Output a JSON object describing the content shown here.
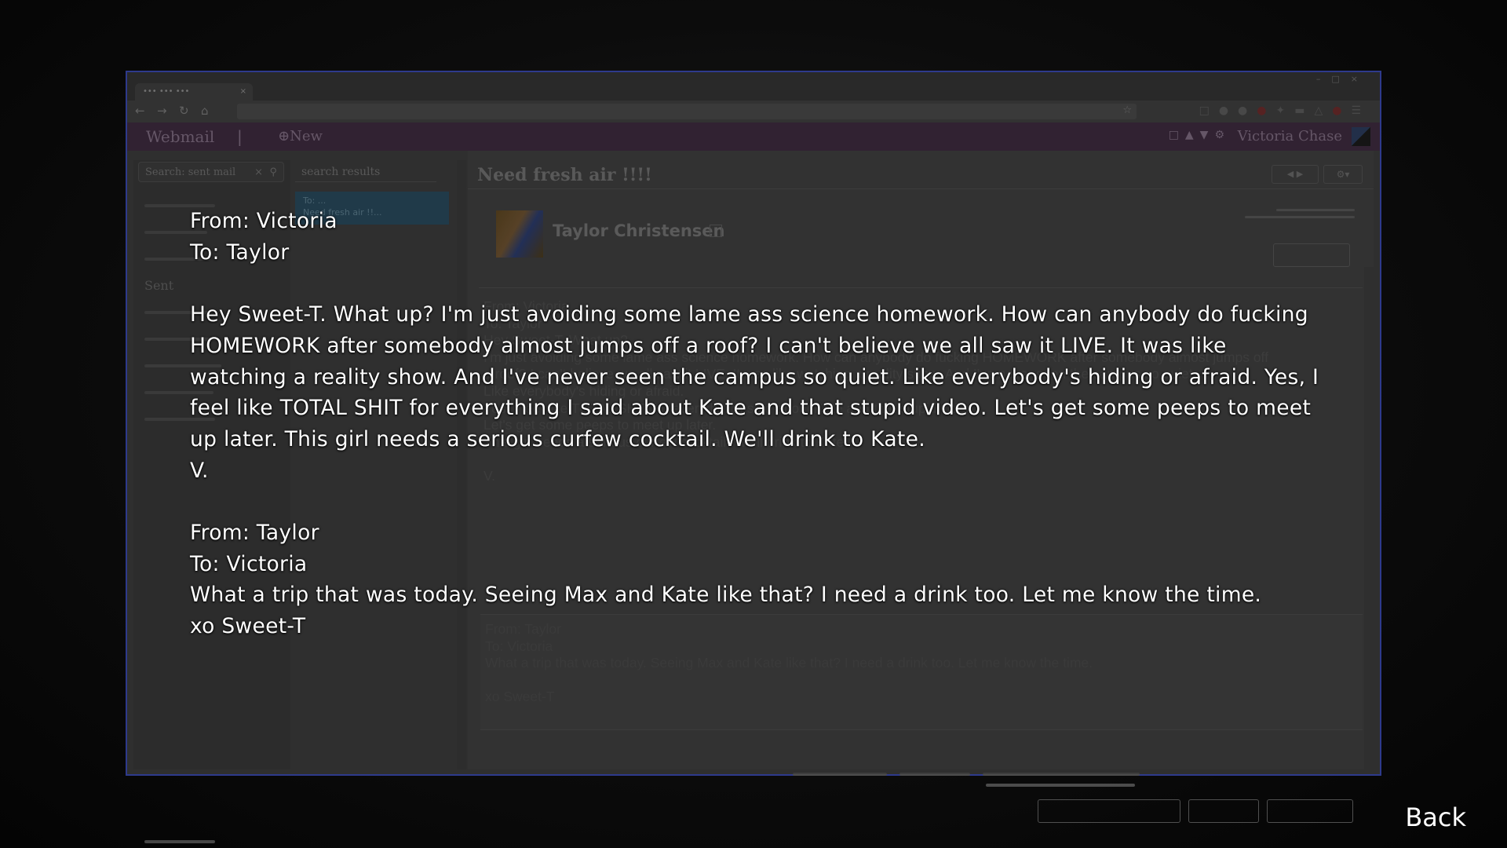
{
  "browser": {
    "tab_title": "••• ••• •••",
    "tab_close": "×"
  },
  "webmail": {
    "brand": "Webmail",
    "new_label": "⊕New",
    "user": "Victoria Chase",
    "search_sent_placeholder": "Search: sent mail",
    "sidebar_sent_label": "Sent",
    "search_results_label": "search results",
    "result_item_from": "To: ...",
    "result_item_subject": "Need fresh air !!...",
    "subject": "Need fresh air !!!!",
    "sender": "Taylor Christensen",
    "body_lines": [
      "From: Victoria",
      "To: Taylor",
      "Hey Sweet-T. What up?",
      "I'm just avoiding some lame ass science homework. How can anybody do fucking HOMEWORK after somebody almost jumps off",
      "a roof? I can't believe we all saw it LIVE. It was like watching a reality show. And I've never seen the campus so quiet.",
      "Like everybody's hiding or afraid.",
      "Yes, I feel like TOTAL SHIT for everything I said about Kate and that stupid video.",
      "Let's get some peeps to meet up later.",
      "This girl needs a serious curfew cocktail. We'll drink to Kate.",
      "",
      "V."
    ],
    "quoted_lines": [
      "From: Taylor",
      "To: Victoria",
      "What a trip that was today. Seeing Max and Kate like that? I need a drink too. Let me know the time.",
      "",
      "xo Sweet-T"
    ]
  },
  "journal": {
    "message1": {
      "from": "From: Victoria",
      "to": "To: Taylor",
      "body": "Hey Sweet-T. What up? I'm just avoiding some lame ass science homework. How can anybody do fucking HOMEWORK after somebody almost jumps off a roof? I can't believe we all saw it LIVE. It was like watching a reality show. And I've never seen the campus so quiet. Like everybody's hiding or afraid. Yes, I feel like TOTAL SHIT for everything I said about Kate and that stupid video. Let's get some peeps to meet up later. This girl needs a serious curfew cocktail. We'll drink to Kate.",
      "sign": "V."
    },
    "message2": {
      "from": "From: Taylor",
      "to": "To: Victoria",
      "body": "What a trip that was today. Seeing Max and Kate like that? I need a drink too. Let me know the time.",
      "sign": "xo Sweet-T"
    }
  },
  "back_label": "Back",
  "colors": {
    "text": "#ffffff",
    "appbar": "#3c2a3e",
    "result_highlight": "#28475a",
    "window_border": "#2e3a8c"
  }
}
